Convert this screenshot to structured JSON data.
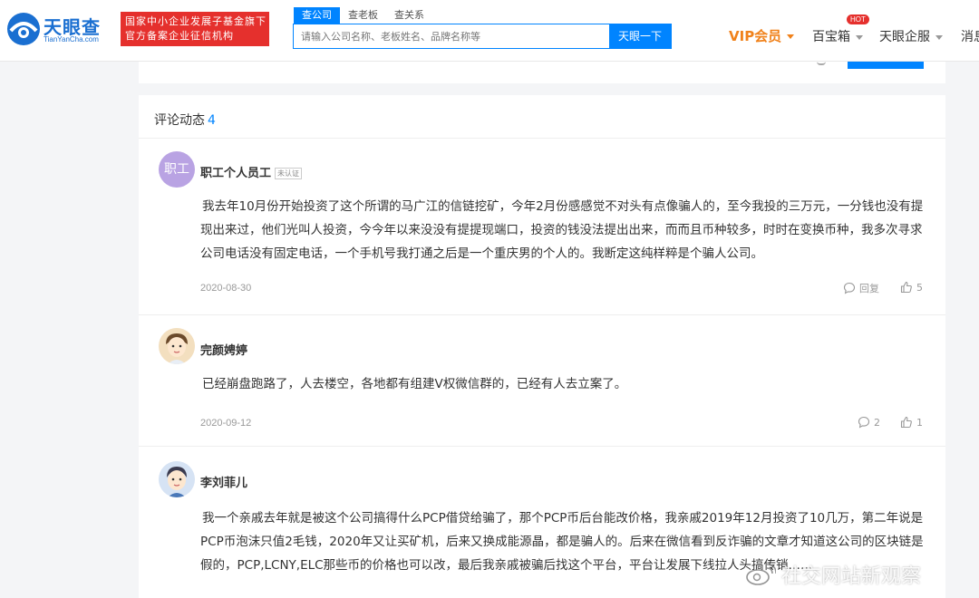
{
  "header": {
    "logo_text": "天眼查",
    "logo_sub": "TianYanCha.com",
    "slogan_line1": "国家中小企业发展子基金旗下",
    "slogan_line2": "官方备案企业征信机构",
    "search_tabs": [
      "查公司",
      "查老板",
      "查关系"
    ],
    "search_placeholder": "请输入公司名称、老板姓名、品牌名称等",
    "search_button": "天眼一下",
    "nav_vip": "VIP会员",
    "nav_baoxiang": "百宝箱",
    "hot_badge": "HOT",
    "nav_qifu": "天眼企服",
    "nav_msg": "消息"
  },
  "comments_section": {
    "title": "评论动态",
    "count": "4",
    "items": [
      {
        "avatar_text": "职工",
        "author": "职工个人员工",
        "badge": "未认证",
        "body": "我去年10月份开始投资了这个所谓的马广江的信链挖矿，今年2月份感感觉不对头有点像骗人的，至今我投的三万元，一分钱也没有提现出来过，他们光叫人投资，今今年以来没没有提提现端口，投资的钱没法提出出来，而而且币种较多，时时在变换币种，我多次寻求公司电话没有固定电话，一个手机号我打通之后是一个重庆男的个人的。我断定这纯样粹是个骗人公司。",
        "date": "2020-08-30",
        "reply_label": "回复",
        "likes": "5"
      },
      {
        "author": "完颜娉婷",
        "body": "已经崩盘跑路了，人去楼空，各地都有组建V权微信群的，已经有人去立案了。",
        "date": "2020-09-12",
        "replies": "2",
        "likes": "1"
      },
      {
        "author": "李刘菲儿",
        "body": "我一个亲戚去年就是被这个公司搞得什么PCP借贷给骗了，那个PCP币后台能改价格，我亲戚2019年12月投资了10几万，第二年说是PCP币泡沫只值2毛钱，2020年又让买矿机，后来又换成能源晶，都是骗人的。后来在微信看到反诈骗的文章才知道这公司的区块链是假的，PCP,LCNY,ELC那些币的价格也可以改，最后我亲戚被骗后找这个平台，平台让发展下线拉人头搞传销……"
      }
    ]
  },
  "watermark": "社交网站新观察"
}
